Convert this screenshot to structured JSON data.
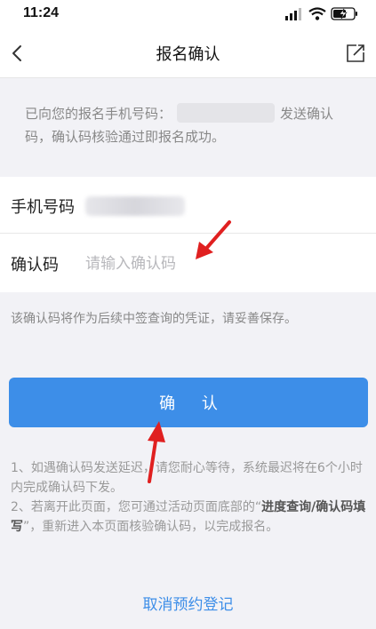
{
  "status_bar": {
    "time": "11:24"
  },
  "nav": {
    "title": "报名确认",
    "back_icon": "chevron-left-icon",
    "share_icon": "share-icon"
  },
  "notice": {
    "prefix": "已向您的报名手机号码：",
    "suffix": "发送确认码，确认码核验通过即报名成功。"
  },
  "form": {
    "phone_label": "手机号码",
    "code_label": "确认码",
    "code_placeholder": "请输入确认码",
    "code_value": ""
  },
  "warning": "该确认码将作为后续中签查询的凭证，请妥善保存。",
  "confirm_button": "确  认",
  "tips": {
    "line1": "1、如遇确认码发送延迟，请您耐心等待，系统最迟将在6个小时内完成确认码下发。",
    "line2_a": "2、若离开此页面，您可通过活动页面底部的“",
    "line2_bold": "进度查询/确认码填写",
    "line2_b": "”，重新进入本页面核验确认码，以完成报名。"
  },
  "cancel_link": "取消预约登记",
  "colors": {
    "accent": "#3d8ee8",
    "annotation_arrow": "#e02020",
    "background": "#f2f2f6"
  }
}
